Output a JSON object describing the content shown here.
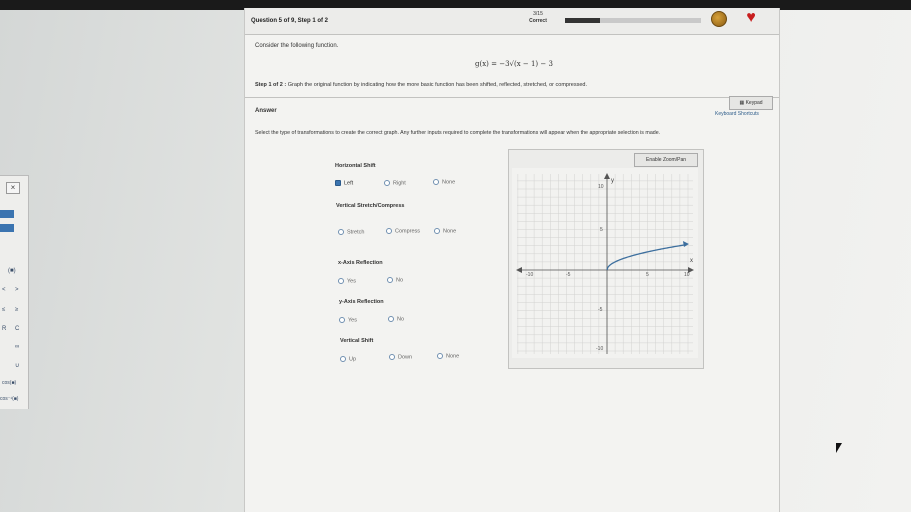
{
  "header": {
    "question_label": "Question 5 of 9, Step 1 of 2",
    "score": "3/15",
    "status": "Correct",
    "progress_fraction": 0.26
  },
  "problem": {
    "consider_text": "Consider the following function.",
    "formula": "g(x) = −3√(x − 1) − 3",
    "step_label": "Step 1 of 2 :",
    "step_text": "Graph the original function by indicating how the more basic function has been shifted, reflected, stretched, or compressed."
  },
  "answer": {
    "label": "Answer",
    "keypad_label": "Keypad",
    "shortcuts_label": "Keyboard Shortcuts",
    "instructions": "Select the type of transformations to create the correct graph. Any further inputs required to complete the transformations will appear when the appropriate selection is made."
  },
  "transformations": {
    "horizontal_shift": {
      "title": "Horizontal Shift",
      "options": [
        "Left",
        "Right",
        "None"
      ],
      "selected": "Left"
    },
    "vertical_stretch": {
      "title": "Vertical Stretch/Compress",
      "options": [
        "Stretch",
        "Compress",
        "None"
      ]
    },
    "x_reflection": {
      "title": "x-Axis Reflection",
      "options": [
        "Yes",
        "No"
      ]
    },
    "y_reflection": {
      "title": "y-Axis Reflection",
      "options": [
        "Yes",
        "No"
      ]
    },
    "vertical_shift": {
      "title": "Vertical Shift",
      "options": [
        "Up",
        "Down",
        "None"
      ]
    }
  },
  "graph": {
    "zoom_button": "Enable Zoom/Pan",
    "x_label": "x",
    "y_label": "y",
    "tick_neg10": "-10",
    "tick_neg5": "-5",
    "tick_5": "5",
    "tick_10": "10",
    "curve": "y = √x"
  },
  "left_panel": {
    "close": "×",
    "keys": [
      "(■)",
      "<",
      ">",
      "≤",
      "≥",
      "R",
      "C",
      "∞",
      "∪",
      "cos(■)",
      "cos⁻¹(■)"
    ]
  }
}
